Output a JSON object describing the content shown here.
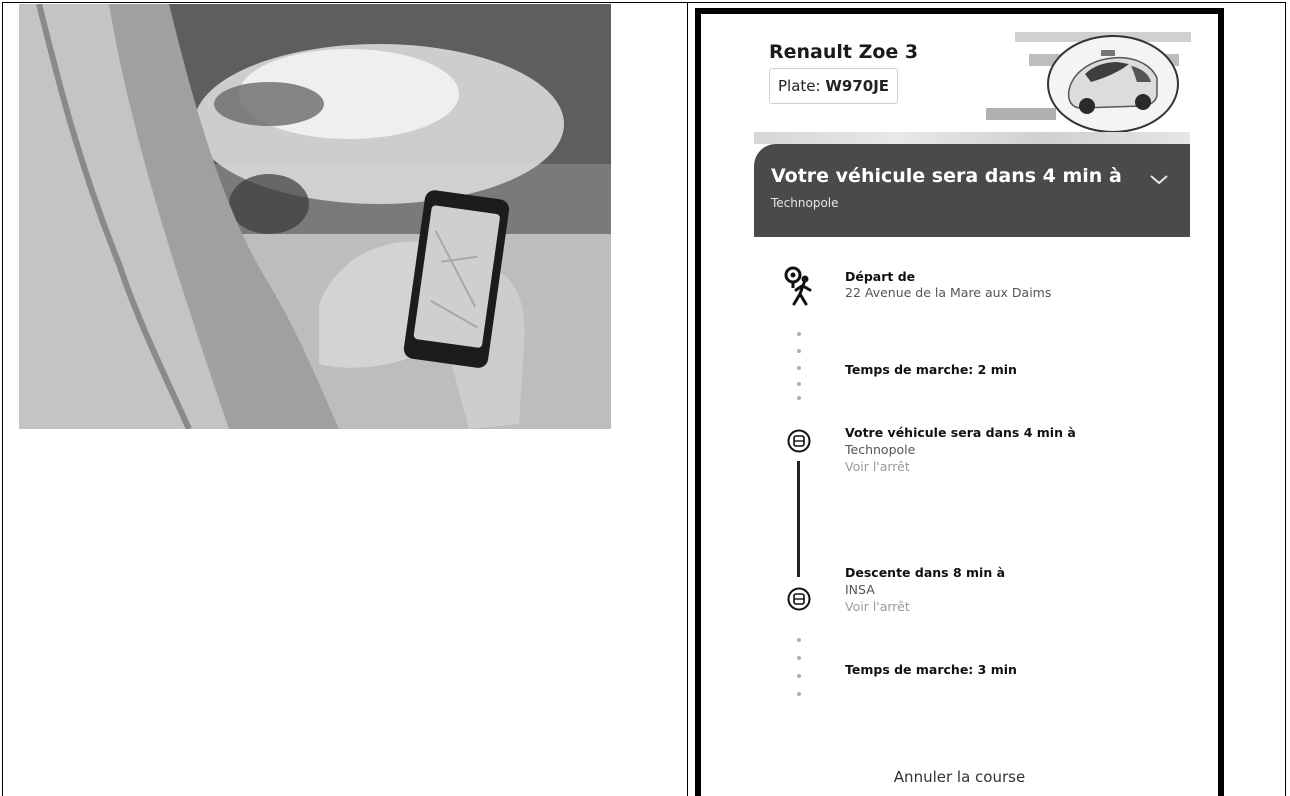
{
  "vehicle": {
    "name": "Renault Zoe 3",
    "plate_label": "Plate:",
    "plate_value": "W970JE"
  },
  "banner": {
    "title": "Votre véhicule sera dans 4 min à",
    "subtitle": "Technopole"
  },
  "steps": [
    {
      "title": "Départ de",
      "line": "22 Avenue de la Mare aux Daims"
    },
    {
      "title": "Temps de marche: 2 min"
    },
    {
      "title": "Votre véhicule sera dans 4 min à",
      "line": "Technopole",
      "link": "Voir l'arrêt"
    },
    {
      "title": "Descente dans 8 min à",
      "line": "INSA",
      "link": "Voir l'arrêt"
    },
    {
      "title": "Temps de marche: 3 min"
    }
  ],
  "cancel_label": "Annuler la course",
  "icons": {
    "walk": "walking-person-pin-icon",
    "bus": "bus-stop-icon",
    "chevron": "chevron-down-icon"
  }
}
